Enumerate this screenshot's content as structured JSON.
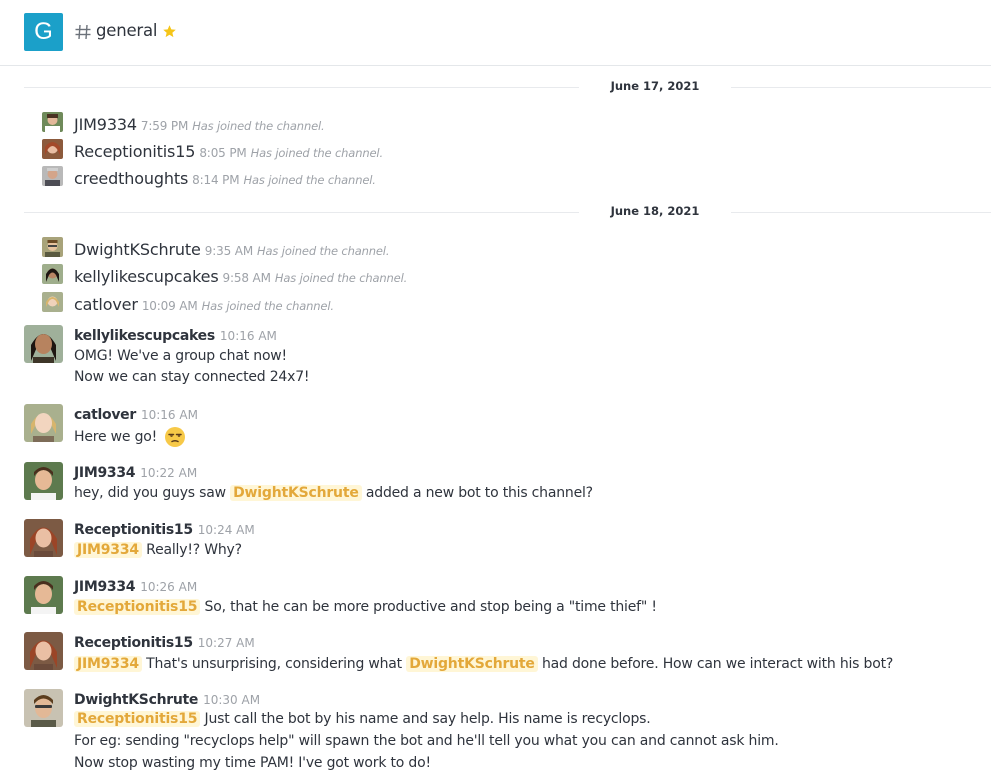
{
  "header": {
    "room_initial": "G",
    "room_name": "general",
    "hash_icon": "channel-hash-icon",
    "star_icon": "favorite-star-icon"
  },
  "colors": {
    "accent": "#1ba0c9",
    "mention_bg": "#fff6d6",
    "mention_text": "#e3a83a",
    "muted": "#9ea2a8",
    "text": "#2f343d",
    "star": "#f5c518"
  },
  "dividers": [
    "June 17, 2021",
    "June 18, 2021"
  ],
  "system_messages": [
    {
      "user": "JIM9334",
      "time": "7:59 PM",
      "text": "Has joined the channel."
    },
    {
      "user": "Receptionitis15",
      "time": "8:05 PM",
      "text": "Has joined the channel."
    },
    {
      "user": "creedthoughts",
      "time": "8:14 PM",
      "text": "Has joined the channel."
    },
    {
      "user": "DwightKSchrute",
      "time": "9:35 AM",
      "text": "Has joined the channel."
    },
    {
      "user": "kellylikescupcakes",
      "time": "9:58 AM",
      "text": "Has joined the channel."
    },
    {
      "user": "catlover",
      "time": "10:09 AM",
      "text": "Has joined the channel."
    }
  ],
  "messages": [
    {
      "user": "kellylikescupcakes",
      "time": "10:16 AM",
      "lines": [
        "OMG! We've a group chat now!",
        "Now we can stay connected 24x7!"
      ]
    },
    {
      "user": "catlover",
      "time": "10:16 AM",
      "lines": [
        "Here we go!"
      ],
      "emoji": "unamused-face-emoji"
    },
    {
      "user": "JIM9334",
      "time": "10:22 AM",
      "parts": [
        "hey, did you guys saw ",
        "DwightKSchrute",
        " added a new bot to this channel?"
      ]
    },
    {
      "user": "Receptionitis15",
      "time": "10:24 AM",
      "parts": [
        "JIM9334",
        " Really!? Why?"
      ]
    },
    {
      "user": "JIM9334",
      "time": "10:26 AM",
      "parts": [
        "Receptionitis15",
        " So, that he can be more productive and stop being a \"time thief\" !"
      ]
    },
    {
      "user": "Receptionitis15",
      "time": "10:27 AM",
      "parts": [
        "JIM9334",
        " That's unsurprising, considering what ",
        "DwightKSchrute",
        " had done before. How can we interact with his bot?"
      ]
    },
    {
      "user": "DwightKSchrute",
      "time": "10:30 AM",
      "parts": [
        "Receptionitis15",
        " Just call the bot by his name and say help. His name is recyclops."
      ],
      "lines": [
        "For eg: sending \"recyclops help\" will spawn the bot and he'll tell you what you can and cannot ask him.",
        "Now stop wasting my time PAM! I've got work to do!"
      ]
    }
  ]
}
